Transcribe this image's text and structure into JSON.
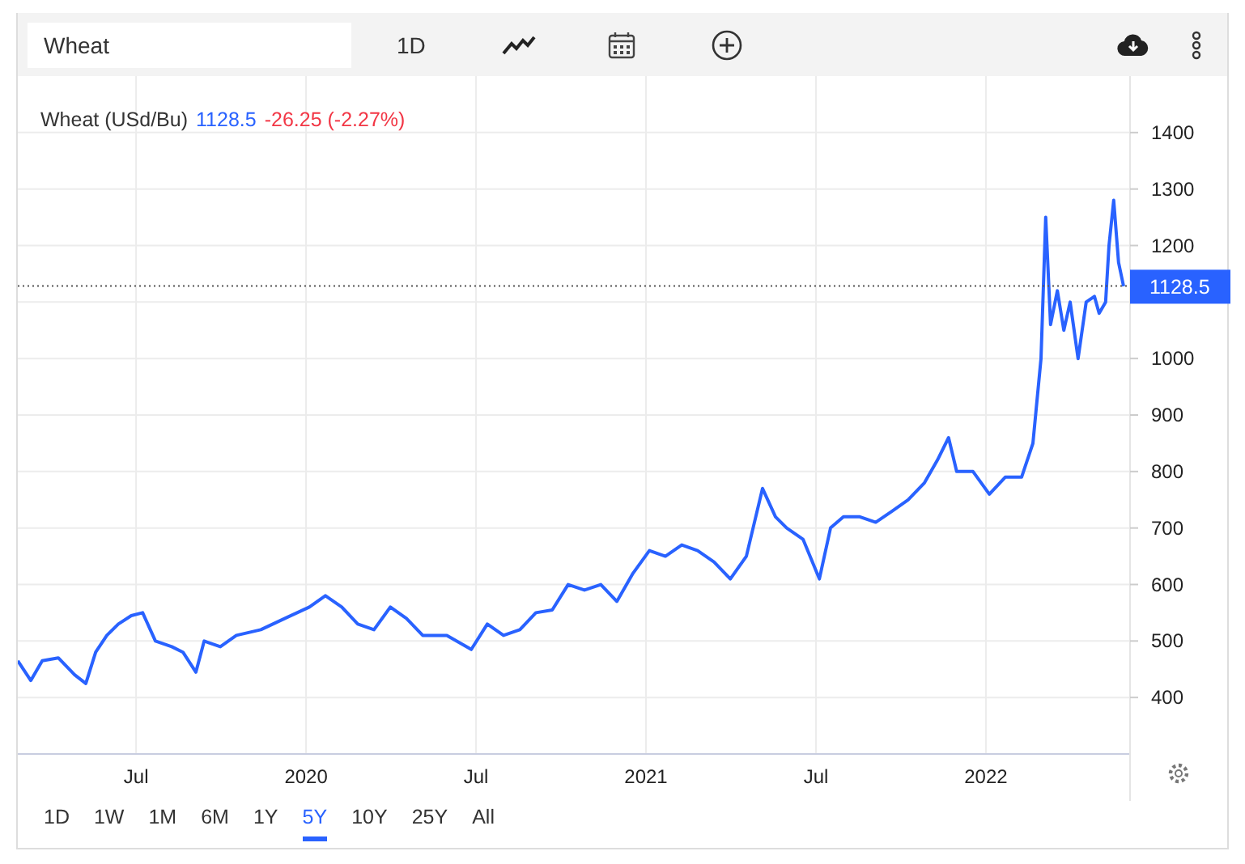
{
  "toolbar": {
    "search": {
      "value": "Wheat"
    },
    "interval": "1D"
  },
  "legend": {
    "price": "1128.5",
    "change": "-26.25 (-2.27%)"
  },
  "chart_data": {
    "type": "line",
    "xlim": [
      2019.152,
      2022.424
    ],
    "ylim": [
      300,
      1500
    ],
    "grid": true,
    "ref_lines": [
      {
        "value": 1128.5,
        "label": "1128.5",
        "color": "#555555",
        "axis": "y"
      }
    ],
    "xticks": [
      {
        "value": 2019.5,
        "label": "Jul"
      },
      {
        "value": 2020,
        "label": "2020"
      },
      {
        "value": 2020.5,
        "label": "Jul"
      },
      {
        "value": 2021,
        "label": "2021"
      },
      {
        "value": 2021.5,
        "label": "Jul"
      },
      {
        "value": 2022,
        "label": "2022"
      }
    ],
    "yticks": [
      400,
      500,
      600,
      700,
      800,
      900,
      1000,
      1200,
      1300,
      1400
    ],
    "x": [
      2019.152,
      2019.19,
      2019.224,
      2019.271,
      2019.319,
      2019.352,
      2019.381,
      2019.414,
      2019.448,
      2019.486,
      2019.519,
      2019.557,
      2019.605,
      2019.638,
      2019.676,
      2019.7,
      2019.748,
      2019.795,
      2019.867,
      2019.938,
      2020.01,
      2020.057,
      2020.105,
      2020.152,
      2020.2,
      2020.248,
      2020.295,
      2020.343,
      2020.414,
      2020.486,
      2020.533,
      2020.581,
      2020.629,
      2020.676,
      2020.724,
      2020.771,
      2020.819,
      2020.867,
      2020.914,
      2020.962,
      2021.01,
      2021.057,
      2021.105,
      2021.152,
      2021.2,
      2021.248,
      2021.295,
      2021.319,
      2021.343,
      2021.381,
      2021.414,
      2021.462,
      2021.51,
      2021.543,
      2021.581,
      2021.629,
      2021.676,
      2021.724,
      2021.771,
      2021.819,
      2021.857,
      2021.89,
      2021.914,
      2021.962,
      2022.01,
      2022.057,
      2022.105,
      2022.138,
      2022.162,
      2022.176,
      2022.19,
      2022.21,
      2022.229,
      2022.248,
      2022.271,
      2022.295,
      2022.319,
      2022.333,
      2022.352,
      2022.362,
      2022.376,
      2022.39,
      2022.405
    ],
    "series": [
      {
        "name": "Wheat (USd/Bu)",
        "color": "#2962ff",
        "values": [
          465,
          430,
          465,
          470,
          440,
          425,
          480,
          510,
          530,
          545,
          550,
          500,
          490,
          480,
          445,
          500,
          490,
          510,
          520,
          540,
          560,
          580,
          560,
          530,
          520,
          560,
          540,
          510,
          510,
          485,
          530,
          510,
          520,
          550,
          555,
          600,
          590,
          600,
          570,
          620,
          660,
          650,
          670,
          660,
          640,
          610,
          650,
          710,
          770,
          720,
          700,
          680,
          610,
          700,
          720,
          720,
          710,
          730,
          750,
          780,
          820,
          860,
          800,
          800,
          760,
          790,
          790,
          850,
          1000,
          1250,
          1060,
          1120,
          1050,
          1100,
          1000,
          1100,
          1110,
          1080,
          1100,
          1200,
          1280,
          1170,
          1128
        ]
      }
    ]
  },
  "ranges": [
    {
      "label": "1D",
      "selected": false
    },
    {
      "label": "1W",
      "selected": false
    },
    {
      "label": "1M",
      "selected": false
    },
    {
      "label": "6M",
      "selected": false
    },
    {
      "label": "1Y",
      "selected": false
    },
    {
      "label": "5Y",
      "selected": true
    },
    {
      "label": "10Y",
      "selected": false
    },
    {
      "label": "25Y",
      "selected": false
    },
    {
      "label": "All",
      "selected": false
    }
  ]
}
